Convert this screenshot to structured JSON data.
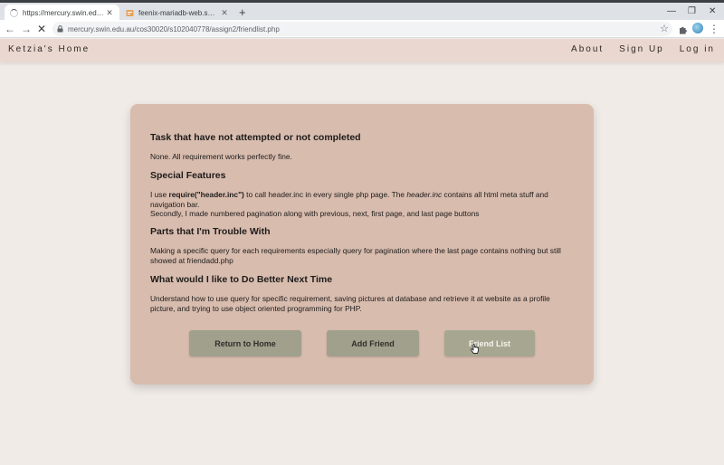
{
  "browser": {
    "tabs": [
      {
        "title": "https://mercury.swin.edu.au/cos",
        "state": "loading"
      },
      {
        "title": "feenix-mariadb-web.swin.edu.au",
        "state": "idle"
      }
    ],
    "new_tab": "+",
    "address_url": "mercury.swin.edu.au/cos30020/s102040778/assign2/friendlist.php",
    "nav_back": "←",
    "nav_forward": "→",
    "nav_stop": "✕",
    "star": "☆",
    "menu": "⋮",
    "win_minimize": "—",
    "win_restore": "❐",
    "win_close": "✕"
  },
  "site": {
    "brand": "Ketzia's Home",
    "nav": [
      "About",
      "Sign Up",
      "Log in"
    ]
  },
  "content": {
    "sections": [
      {
        "heading": "Task that have not attempted or not completed",
        "body": "None. All requirement works perfectly fine."
      },
      {
        "heading": "Special Features",
        "line1_prefix": "I use ",
        "line1_code": "require(\"header.inc\")",
        "line1_mid": " to call header.inc in every single php page. The ",
        "line1_italic": "header.inc",
        "line1_suffix": " contains all html meta stuff and navigation bar.",
        "line2": "Secondly, I made numbered pagination along with previous, next, first page, and last page buttons"
      },
      {
        "heading": "Parts that I'm Trouble With",
        "body": "Making a specific query for each requirements especially query for pagination where the last page contains nothing but still showed at friendadd.php"
      },
      {
        "heading": "What would I like to Do Better Next Time",
        "body": "Understand how to use query for specific requirement, saving pictures at database and retrieve it at website as a profile picture, and trying to use object oriented programming for PHP."
      }
    ],
    "buttons": [
      "Return to Home",
      "Add Friend",
      "Friend List"
    ]
  },
  "colors": {
    "page_bg": "#f1ebe8",
    "header_bg": "#ead8d0",
    "card_bg": "#d8bcae",
    "button_bg": "#a0a08d"
  }
}
